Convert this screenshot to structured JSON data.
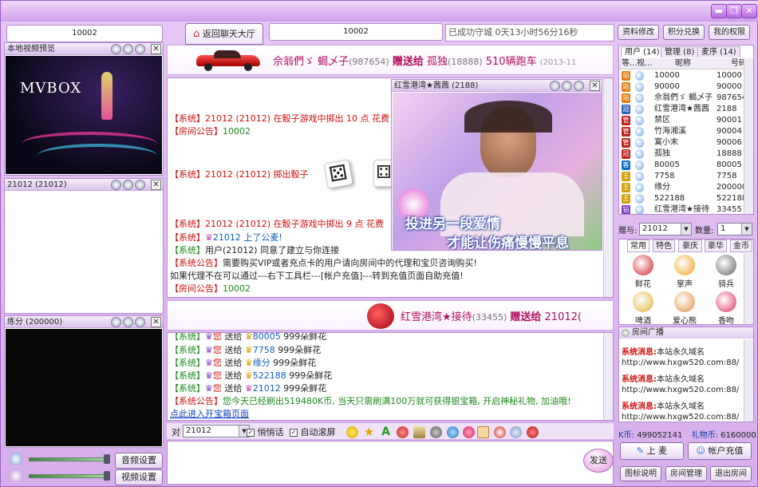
{
  "window": {
    "controls": [
      "▬",
      "❐",
      "✕"
    ]
  },
  "left": {
    "room_id": "10002",
    "preview_title": "本地视频预览",
    "mvbox_logo": "MVBOX",
    "user_video_title": "21012 (21012)",
    "score_title": "练分 (200000)",
    "audio_btn": "音频设置",
    "video_btn": "视频设置"
  },
  "top": {
    "back_btn": "返回聊天大厅",
    "room_box": "10002",
    "status": "已成功守城  0天13小时56分16秒",
    "profile_btn": "资料修改",
    "points_btn": "积分兑换",
    "perm_btn": "我的权限"
  },
  "banner1": {
    "text_from": "佘翁們ゞ 蝎乄子",
    "text_from_id": "(987654)",
    "action": "赠送给",
    "to": "孤独",
    "to_id": "(18888)",
    "gift": "510辆跑车",
    "date": "(2013-11"
  },
  "banner2": {
    "text_from": "红雪港湾★接待",
    "text_from_id": "(33455)",
    "action": "赠送给",
    "to": "21012("
  },
  "video_popup": {
    "title": "红雪港湾★茜茜 (2188)",
    "lyric1": "投进另一段爱情",
    "lyric2": "才能让伤痛慢慢平息"
  },
  "chat_upper": [
    {
      "tag": "【系统】",
      "body": "21012 (21012) 在骰子游戏中掷出 10 点 花费",
      "c": "r"
    },
    {
      "tag": "【房间公告】",
      "body": "10002",
      "c": "g"
    },
    {
      "tag": "【系统】",
      "body": "21012 (21012) 掷出骰子",
      "c": "r"
    },
    {
      "tag": "【系统】",
      "body": "21012 (21012) 在骰子游戏中掷出 9 点 花费",
      "c": "r"
    },
    {
      "tag": "【系统】",
      "body": "21012 上了公麦!",
      "c": "b"
    },
    {
      "tag": "【系统】",
      "body": "用户(21012) 同意了建立与你连接",
      "c": "k"
    },
    {
      "tag": "【系统公告】",
      "body": "需要购买VIP或者充点卡的用户请向房间中的代理和宝贝咨询购买!",
      "c": "k"
    },
    {
      "tag": "",
      "body": "如果代理不在可以通过---右下工具栏---[帐户充值]---转到充值页面自助充值!",
      "c": "k"
    },
    {
      "tag": "【房间公告】",
      "body": "10002",
      "c": "g"
    }
  ],
  "chat_lower": [
    {
      "tag": "【系统】",
      "you": "您",
      "act": "送给",
      "to": "80005",
      "gift": "999朵鲜花"
    },
    {
      "tag": "【系统】",
      "you": "您",
      "act": "送给",
      "to": "7758",
      "gift": "999朵鲜花"
    },
    {
      "tag": "【系统】",
      "you": "您",
      "act": "送给",
      "to": "缘分",
      "gift": "999朵鲜花"
    },
    {
      "tag": "【系统】",
      "you": "您",
      "act": "送给",
      "to": "522188",
      "gift": "999朵鲜花"
    },
    {
      "tag": "【系统】",
      "you": "您",
      "act": "送给",
      "to": "21012",
      "gift": "999朵鲜花"
    }
  ],
  "chat_notice": {
    "tag": "【系统公告】",
    "body": "您今天已经刷出519480K币, 当天只需刷满100万就可获得银宝箱, 开启神秘礼物, 加油哦!"
  },
  "chat_link": "点此进入开宝箱页面",
  "input_bar": {
    "to_label": "对",
    "to_value": "21012",
    "whisper": "悄悄话",
    "autoscroll": "自动滚屏",
    "send": "发送"
  },
  "users": {
    "tabs": [
      "用户 (14)",
      "管理 (8)",
      "麦序 (14)"
    ],
    "headers": [
      "等...",
      "视...",
      "昵称",
      "号码"
    ],
    "rows": [
      {
        "badge": "站",
        "bc": "#e08010",
        "name": "10000",
        "id": "10000"
      },
      {
        "badge": "站",
        "bc": "#e08010",
        "name": "90000",
        "id": "90000"
      },
      {
        "badge": "站",
        "bc": "#e08010",
        "name": "佘翁們ゞ 蝎乄子",
        "id": "987654"
      },
      {
        "badge": "冠",
        "bc": "#3060c0",
        "name": "红雪港湾★茜茜",
        "id": "2188"
      },
      {
        "badge": "管",
        "bc": "#c02020",
        "name": "禁区",
        "id": "90001"
      },
      {
        "badge": "管",
        "bc": "#c02020",
        "name": "竹海湘溪",
        "id": "90004"
      },
      {
        "badge": "管",
        "bc": "#c02020",
        "name": "寞小末",
        "id": "90006"
      },
      {
        "badge": "冠",
        "bc": "#c02020",
        "name": "孤独",
        "id": "18888"
      },
      {
        "badge": "客",
        "bc": "#1070c0",
        "name": "80005",
        "id": "80005"
      },
      {
        "badge": "王",
        "bc": "#d0a000",
        "name": "7758",
        "id": "7758"
      },
      {
        "badge": "王",
        "bc": "#d0a000",
        "name": "缘分",
        "id": "200000"
      },
      {
        "badge": "王",
        "bc": "#d0a000",
        "name": "522188",
        "id": "522188"
      },
      {
        "badge": "钻",
        "bc": "#8040c0",
        "name": "红雪港湾★接待",
        "id": "33455"
      }
    ]
  },
  "gift_panel": {
    "to_label": "赠与:",
    "to_value": "21012",
    "qty_label": "数量:",
    "qty_value": "1",
    "tabs": [
      "常用",
      "特色",
      "豪庆",
      "豪华",
      "金币"
    ],
    "items": [
      {
        "name": "鲜花",
        "col": "#d0202a"
      },
      {
        "name": "掌声",
        "col": "#f0a020"
      },
      {
        "name": "骑兵",
        "col": "#606060"
      },
      {
        "name": "啤酒",
        "col": "#e0b030"
      },
      {
        "name": "爱心熊",
        "col": "#e09040"
      },
      {
        "name": "香吻",
        "col": "#e03060"
      }
    ]
  },
  "broadcast": {
    "title": "房间广播",
    "lines": [
      {
        "tag": "系统消息:",
        "body": "本站永久域名",
        "c": "r"
      },
      {
        "tag": "",
        "body": "http://www.hxgw520.com:88/",
        "c": "k"
      },
      {
        "tag": "系统消息:",
        "body": "本站永久域名",
        "c": "r"
      },
      {
        "tag": "",
        "body": "http://www.hxgw520.com:88/",
        "c": "k"
      },
      {
        "tag": "系统消息:",
        "body": "本站永久域名",
        "c": "r"
      },
      {
        "tag": "",
        "body": "http://www.hxgw520.com:88/",
        "c": "k"
      }
    ]
  },
  "account": {
    "k_label": "K币:",
    "k_value": "499052141",
    "gift_label": "礼物币:",
    "gift_value": "6160000"
  },
  "bottom_btns": {
    "mic": "上 麦",
    "recharge": "帐户充值",
    "icons": "图标说明",
    "room_mgr": "房间管理",
    "exit": "退出房间"
  }
}
